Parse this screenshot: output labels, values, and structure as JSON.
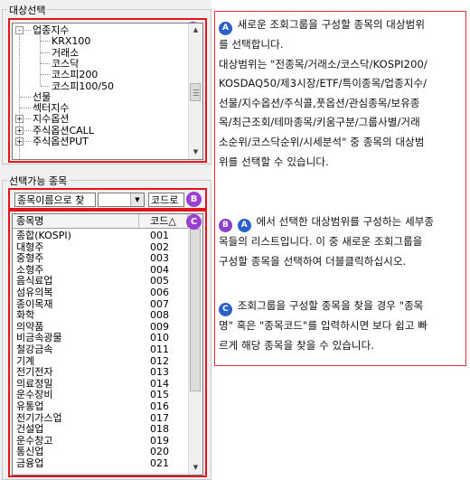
{
  "target_group": {
    "title": "대상선택",
    "badge": "A",
    "tree": [
      {
        "label": "업종지수",
        "level": 0,
        "expander": "-"
      },
      {
        "label": "KRX100",
        "level": 1
      },
      {
        "label": "거래소",
        "level": 1
      },
      {
        "label": "코스닥",
        "level": 1
      },
      {
        "label": "코스피200",
        "level": 1
      },
      {
        "label": "코스피100/50",
        "level": 1
      },
      {
        "label": "선물",
        "level": 0
      },
      {
        "label": "섹터지수",
        "level": 0
      },
      {
        "label": "지수옵션",
        "level": 0,
        "expander": "+"
      },
      {
        "label": "주식옵션CALL",
        "level": 0,
        "expander": "+"
      },
      {
        "label": "주식옵션PUT",
        "level": 0,
        "expander": "+"
      }
    ]
  },
  "selectable_group": {
    "title": "선택가능 종목",
    "badge_b": "B",
    "badge_c": "C",
    "search": {
      "value": "종목이름으로 찾",
      "code_value": "코드로"
    },
    "list": {
      "columns": [
        "종목명",
        "코드△"
      ],
      "rows": [
        [
          "종합(KOSPI)",
          "001"
        ],
        [
          "대형주",
          "002"
        ],
        [
          "중형주",
          "003"
        ],
        [
          "소형주",
          "004"
        ],
        [
          "음식료업",
          "005"
        ],
        [
          "섬유의복",
          "006"
        ],
        [
          "종이목재",
          "007"
        ],
        [
          "화학",
          "008"
        ],
        [
          "의약품",
          "009"
        ],
        [
          "비금속광물",
          "010"
        ],
        [
          "철강금속",
          "011"
        ],
        [
          "기계",
          "012"
        ],
        [
          "전기전자",
          "013"
        ],
        [
          "의료정밀",
          "014"
        ],
        [
          "운수장비",
          "015"
        ],
        [
          "유통업",
          "016"
        ],
        [
          "전기가스업",
          "017"
        ],
        [
          "건설업",
          "018"
        ],
        [
          "운수창고",
          "019"
        ],
        [
          "통신업",
          "020"
        ],
        [
          "금융업",
          "021"
        ]
      ]
    }
  },
  "description": {
    "badge_a": "A",
    "badge_b": "B",
    "badge_c": "C",
    "a_badge_inline": "A",
    "para_a": [
      "새로운 조회그룹을 구성할 종목의 대상범위",
      "를 선택합니다.",
      "대상범위는 \"전종목/거래소/코스닥/KOSPI200/",
      "KOSDAQ50/제3시장/ETF/특이종목/업종지수/",
      "선물/지수옵션/주식콜,풋옵션/관심종목/보유종",
      "목/최근조회/테마종목/키움구분/그룹사별/거래",
      "소순위/코스닥순위/시세분석\" 중 종목의 대상범",
      "위를 선택할 수 있습니다."
    ],
    "para_b": [
      "에서 선택한 대상범위를 구성하는 세부종",
      "목들의 리스트입니다. 이 중 새로운 조회그룹을",
      "구성할 종목을 선택하여 더블클릭하십시오."
    ],
    "para_c": [
      "조회그룹을 구성할 종목을 찾을 경우 \"종목",
      "명\" 혹은 \"종목코드\"를 입력하시면 보다 쉽고 빠",
      "르게 해당 종목을 찾을 수 있습니다."
    ]
  }
}
